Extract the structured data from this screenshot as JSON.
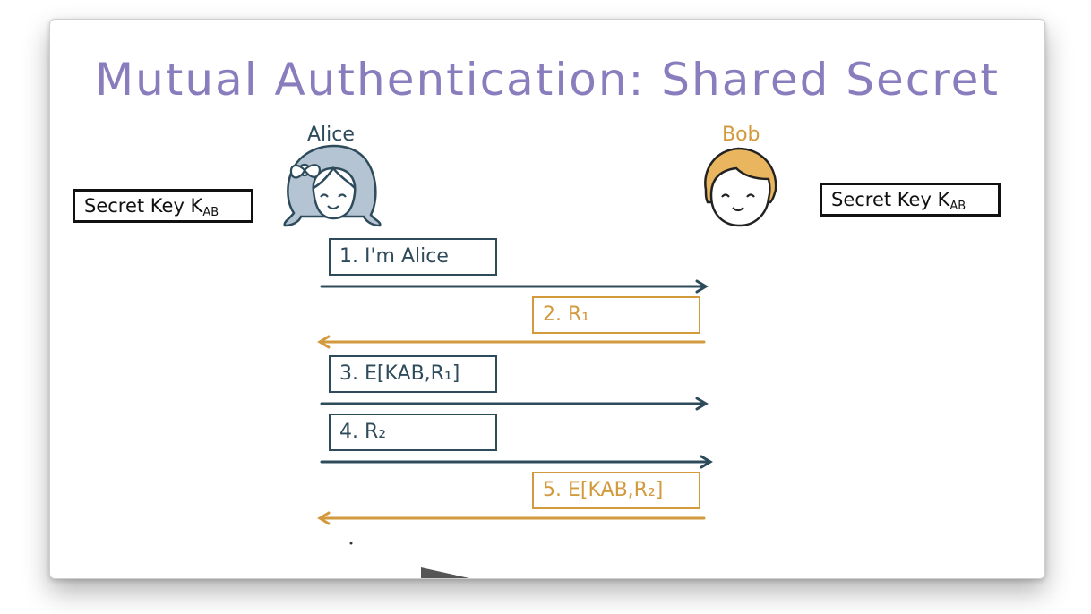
{
  "title": "Mutual Authentication: Shared Secret",
  "alice": {
    "name": "Alice",
    "key_label": "Secret Key K",
    "key_sub": "AB"
  },
  "bob": {
    "name": "Bob",
    "key_label": "Secret Key K",
    "key_sub": "AB"
  },
  "messages": [
    {
      "step": "1.",
      "text": "I'm Alice",
      "direction": "alice-to-bob"
    },
    {
      "step": "2.",
      "text": "R₁",
      "direction": "bob-to-alice"
    },
    {
      "step": "3.",
      "text": "E[KAB,R₁]",
      "direction": "alice-to-bob"
    },
    {
      "step": "4.",
      "text": "R₂",
      "direction": "alice-to-bob"
    },
    {
      "step": "5.",
      "text": "E[KAB,R₂]",
      "direction": "bob-to-alice"
    }
  ],
  "colors": {
    "title": "#8a7dbe",
    "alice": "#2e4b5c",
    "bob": "#d39a3d"
  }
}
